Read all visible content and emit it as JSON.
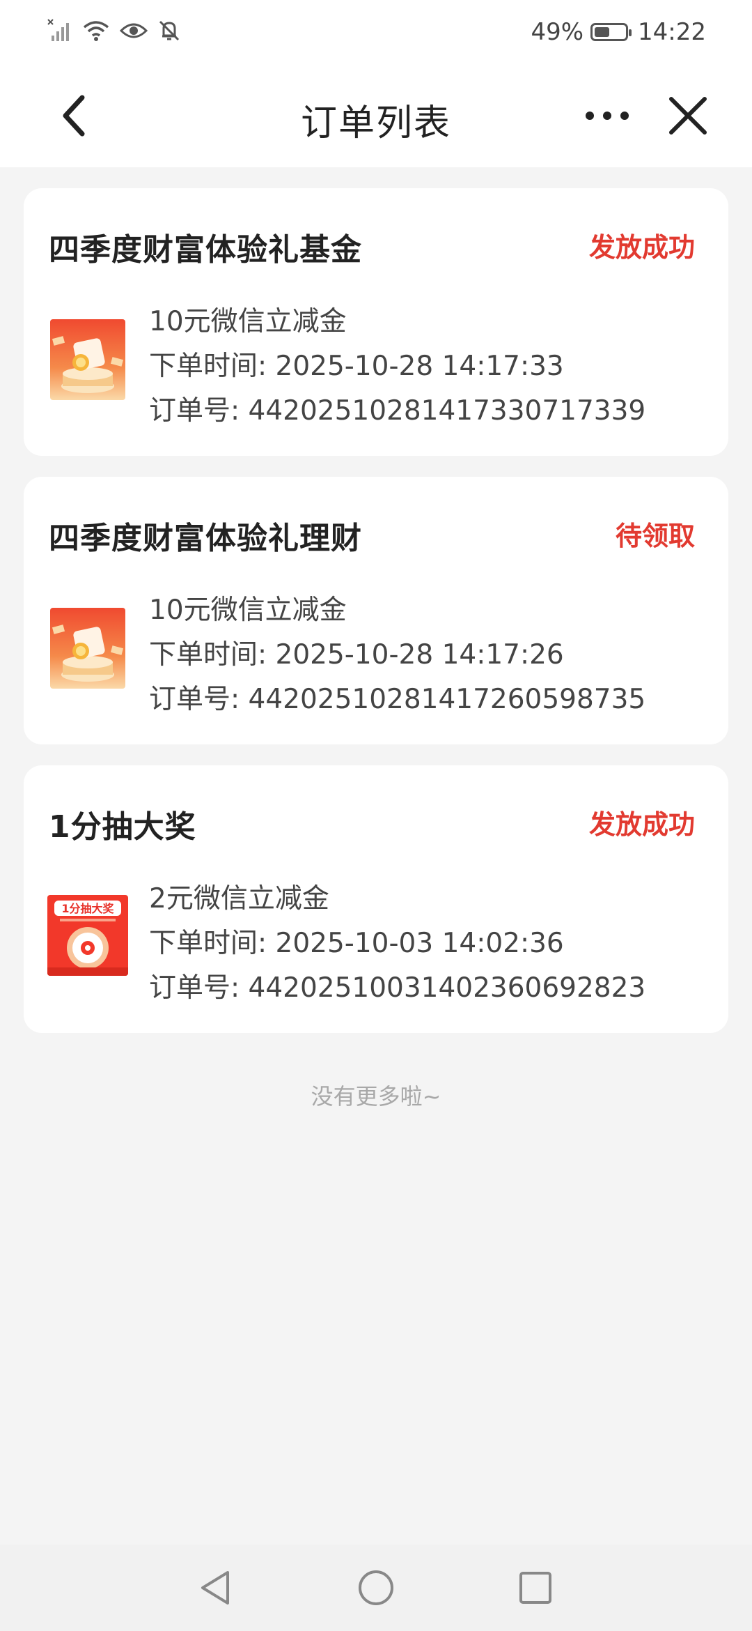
{
  "status_bar": {
    "battery_percent": "49%",
    "battery_level": 0.49,
    "time": "14:22",
    "icons": [
      "no-signal-icon",
      "wifi-icon",
      "eye-icon",
      "mute-bell-icon",
      "battery-icon"
    ]
  },
  "header": {
    "title": "订单列表",
    "icons": [
      "back-arrow-icon",
      "more-dots-icon",
      "close-icon"
    ]
  },
  "orders": [
    {
      "title": "四季度财富体验礼基金",
      "status": "发放成功",
      "item": "10元微信立减金",
      "order_time": "下单时间: 2025-10-28 14:17:33",
      "order_no": "订单号: 44202510281417330717339",
      "thumb_icon": "gift-coupon-icon"
    },
    {
      "title": "四季度财富体验礼理财",
      "status": "待领取",
      "item": "10元微信立减金",
      "order_time": "下单时间: 2025-10-28 14:17:26",
      "order_no": "订单号: 44202510281417260598735",
      "thumb_icon": "gift-coupon-icon"
    },
    {
      "title": "1分抽大奖",
      "status": "发放成功",
      "item": "2元微信立减金",
      "order_time": "下单时间: 2025-10-03 14:02:36",
      "order_no": "订单号: 44202510031402360692823",
      "thumb_icon": "lottery-wheel-icon",
      "thumb_text": "1分抽大奖"
    }
  ],
  "footer_hint": "没有更多啦~",
  "nav_bar": {
    "icons": [
      "nav-back-icon",
      "nav-home-icon",
      "nav-recents-icon"
    ]
  },
  "colors": {
    "accent_red": "#e23a30",
    "background": "#f4f4f4"
  }
}
